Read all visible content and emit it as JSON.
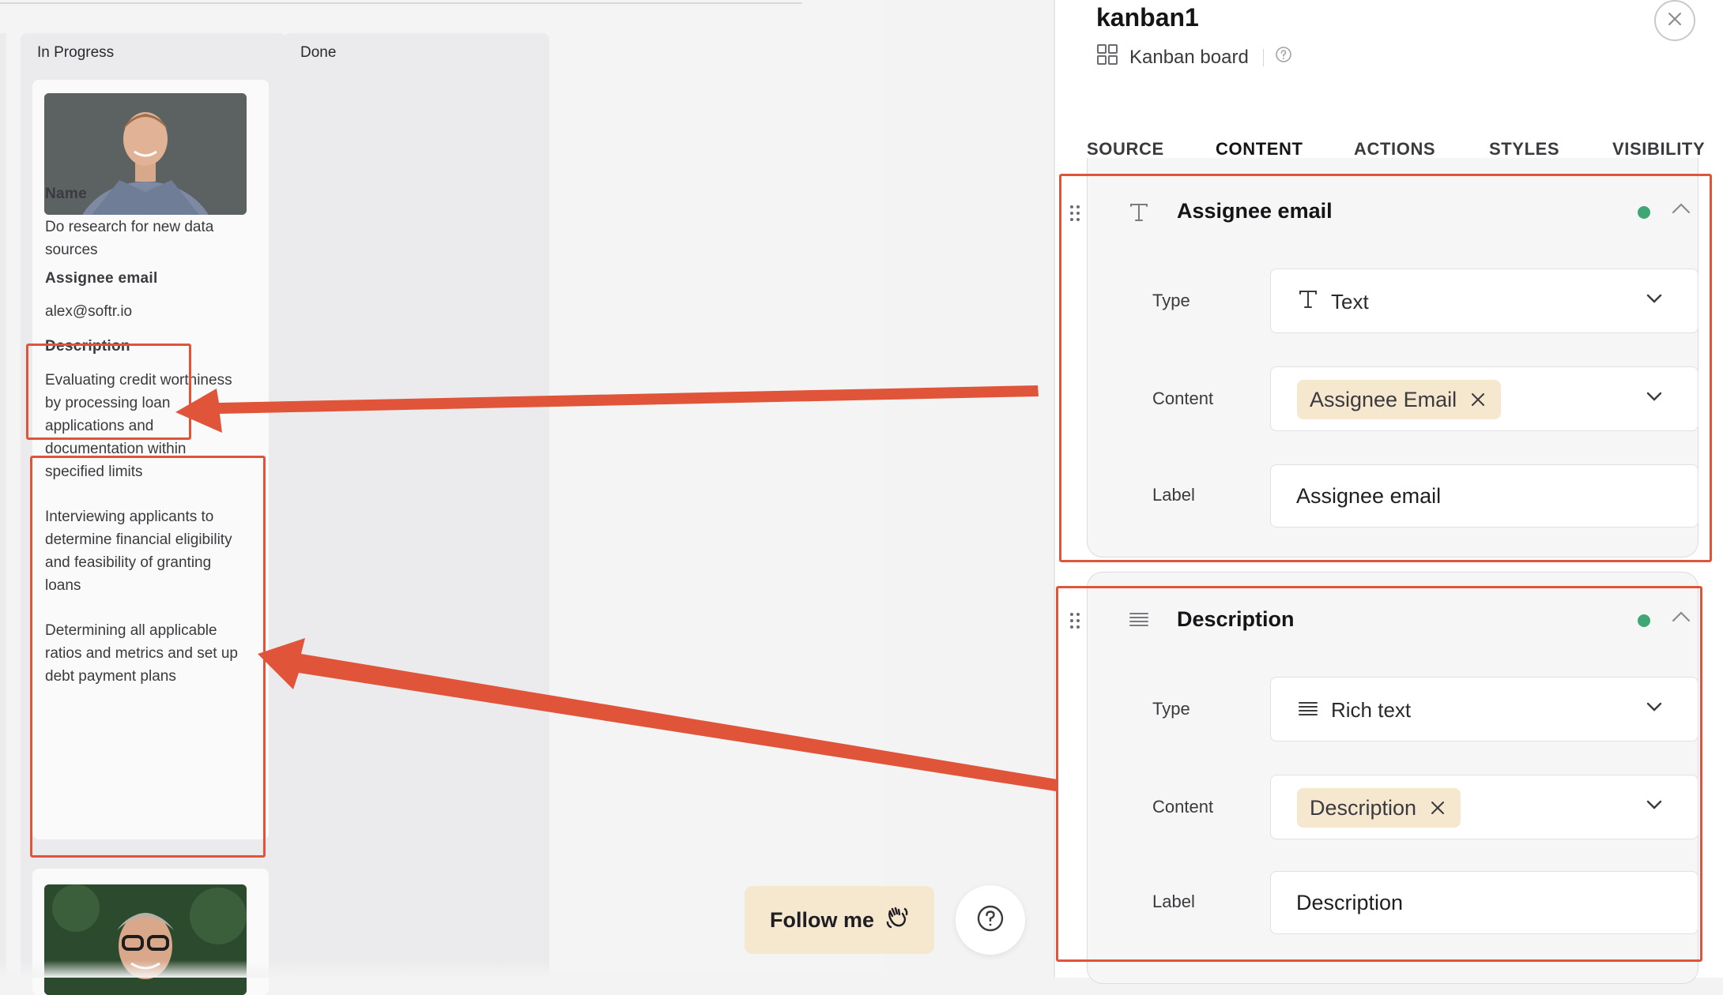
{
  "board": {
    "columns": [
      {
        "title": "In Progress"
      },
      {
        "title": "Done"
      }
    ],
    "card": {
      "name_label": "Name",
      "name_value": "Do research for new data sources",
      "email_label": "Assignee email",
      "email_value": "alex@softr.io",
      "description_label": "Description",
      "description_paragraphs": [
        "Evaluating credit worthiness by processing loan applications and documentation within specified limits",
        "Interviewing applicants to determine financial eligibility and feasibility of granting loans",
        "Determining all applicable ratios and metrics and set up debt payment plans"
      ]
    }
  },
  "floating": {
    "follow_label": "Follow me",
    "follow_icon": "waving-hand-icon",
    "help_icon": "question-circle-icon"
  },
  "panel": {
    "title": "kanban1",
    "subtitle": "Kanban board",
    "tabs": [
      "SOURCE",
      "CONTENT",
      "ACTIONS",
      "STYLES",
      "VISIBILITY"
    ],
    "active_tab": "CONTENT",
    "fields": [
      {
        "title": "Assignee email",
        "title_icon": "text-type-icon",
        "type_label": "Type",
        "type_value": "Text",
        "content_label": "Content",
        "content_chip": "Assignee Email",
        "label_label": "Label",
        "label_value": "Assignee email"
      },
      {
        "title": "Description",
        "title_icon": "rich-text-icon",
        "type_label": "Type",
        "type_value": "Rich text",
        "content_label": "Content",
        "content_chip": "Description",
        "label_label": "Label",
        "label_value": "Description"
      }
    ]
  },
  "colors": {
    "accent": "#f0a63a",
    "highlight": "#e0553a",
    "chip": "#f6e7cf",
    "status_on": "#3fa773"
  }
}
